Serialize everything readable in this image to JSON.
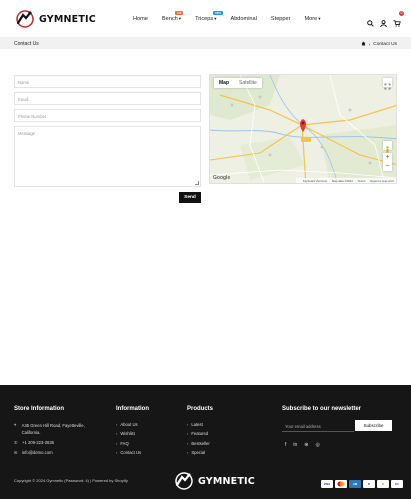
{
  "brand": {
    "name": "GYMNETIC"
  },
  "nav": [
    {
      "label": "Home"
    },
    {
      "label": "Bench",
      "badge": "hot",
      "caret": "▾"
    },
    {
      "label": "Triceps",
      "badge": "new",
      "caret": "▾"
    },
    {
      "label": "Abdominal"
    },
    {
      "label": "Stepper"
    },
    {
      "label": "More",
      "caret": "▾"
    }
  ],
  "header_icons": [
    "search-icon",
    "user-icon",
    "cart-icon"
  ],
  "cart": {
    "count": "0"
  },
  "breadcrumb": {
    "title": "Contact Us",
    "current": "Contact Us"
  },
  "form": {
    "name_placeholder": "Name",
    "email_placeholder": "Email",
    "phone_placeholder": "Phone Number",
    "message_placeholder": "Message",
    "send_label": "Send"
  },
  "map": {
    "tab_map": "Map",
    "tab_satellite": "Satellite",
    "footer_items": [
      "Keyboard shortcuts",
      "Map data ©2024",
      "Terms",
      "Report a map error"
    ],
    "google_label": "Google"
  },
  "footer": {
    "store_title": "Store Information",
    "store_address": "A35 Green Hill Road, Fayetteville, California.",
    "store_phone": "+1 209-223-2635",
    "store_email": "info@demo.com",
    "info_title": "Information",
    "info_links": [
      "About Us",
      "Wishlist",
      "FAQ",
      "Contact Us"
    ],
    "products_title": "Products",
    "products_links": [
      "Latest",
      "Featured",
      "Bestseller",
      "Special"
    ],
    "news_title": "Subscribe to our newsletter",
    "news_placeholder": "Your email address",
    "subscribe_label": "Subscribe",
    "social_icons": [
      "facebook-icon",
      "linkedin-icon",
      "pinterest-icon",
      "instagram-icon"
    ],
    "copyright": "Copyright © 2024 Gymnetic (Password: 4) | Powered by Shopify",
    "payments": [
      "visa",
      "mastercard",
      "amex",
      "paypal",
      "discover",
      "diners"
    ]
  }
}
